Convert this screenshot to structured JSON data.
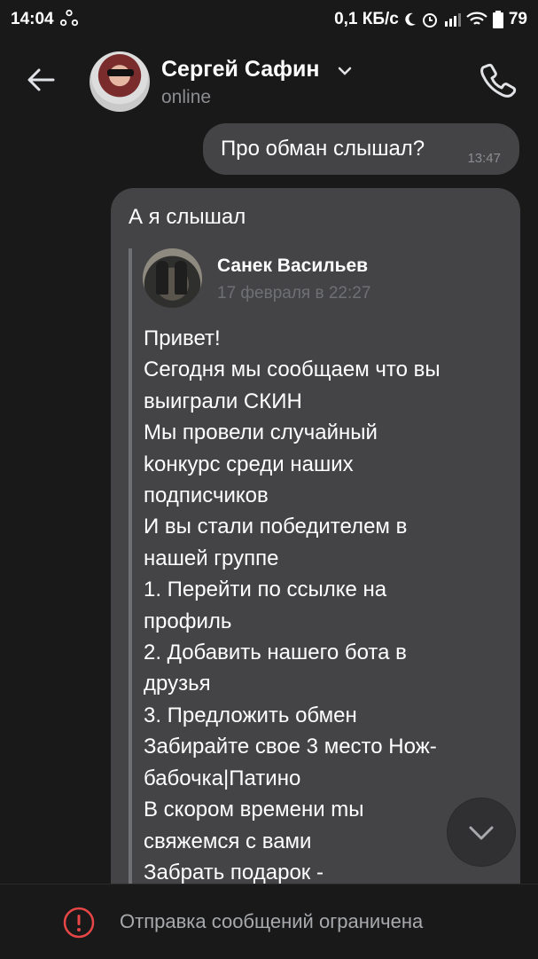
{
  "status_bar": {
    "time": "14:04",
    "network_speed": "0,1 КБ/с",
    "battery": "79"
  },
  "header": {
    "contact_name": "Сергей Сафин",
    "contact_status": "online"
  },
  "messages": {
    "outgoing": {
      "text": "Про обман слышал?",
      "time": "13:47"
    },
    "incoming": {
      "text": "А я слышал",
      "forwarded": {
        "author": "Санек Васильев",
        "date": "17 февраля в 22:27",
        "lines": [
          "Привет!",
          "Сегодня мы сообщаем что вы",
          "выиграли СКИН",
          "Мы провели случайный",
          "kонкурс среди наших",
          "подписчиков",
          "И вы стали победителем в",
          "нашей группе",
          "1. Перейти по ссылке на",
          "профиль",
          "2. Добавить нашего бота в",
          "друзья",
          "3. Предложить обмен",
          "Забирайте свое 3 место Нож-",
          "бабочка|Патино",
          "В скором времени mы",
          "свяжемся с вами",
          "Забрать подарок -"
        ]
      }
    }
  },
  "footer": {
    "restriction_text": "Отправка сообщений ограничена"
  },
  "colors": {
    "background": "#19191a",
    "bubble": "#444446",
    "warning_red": "#e64646"
  }
}
